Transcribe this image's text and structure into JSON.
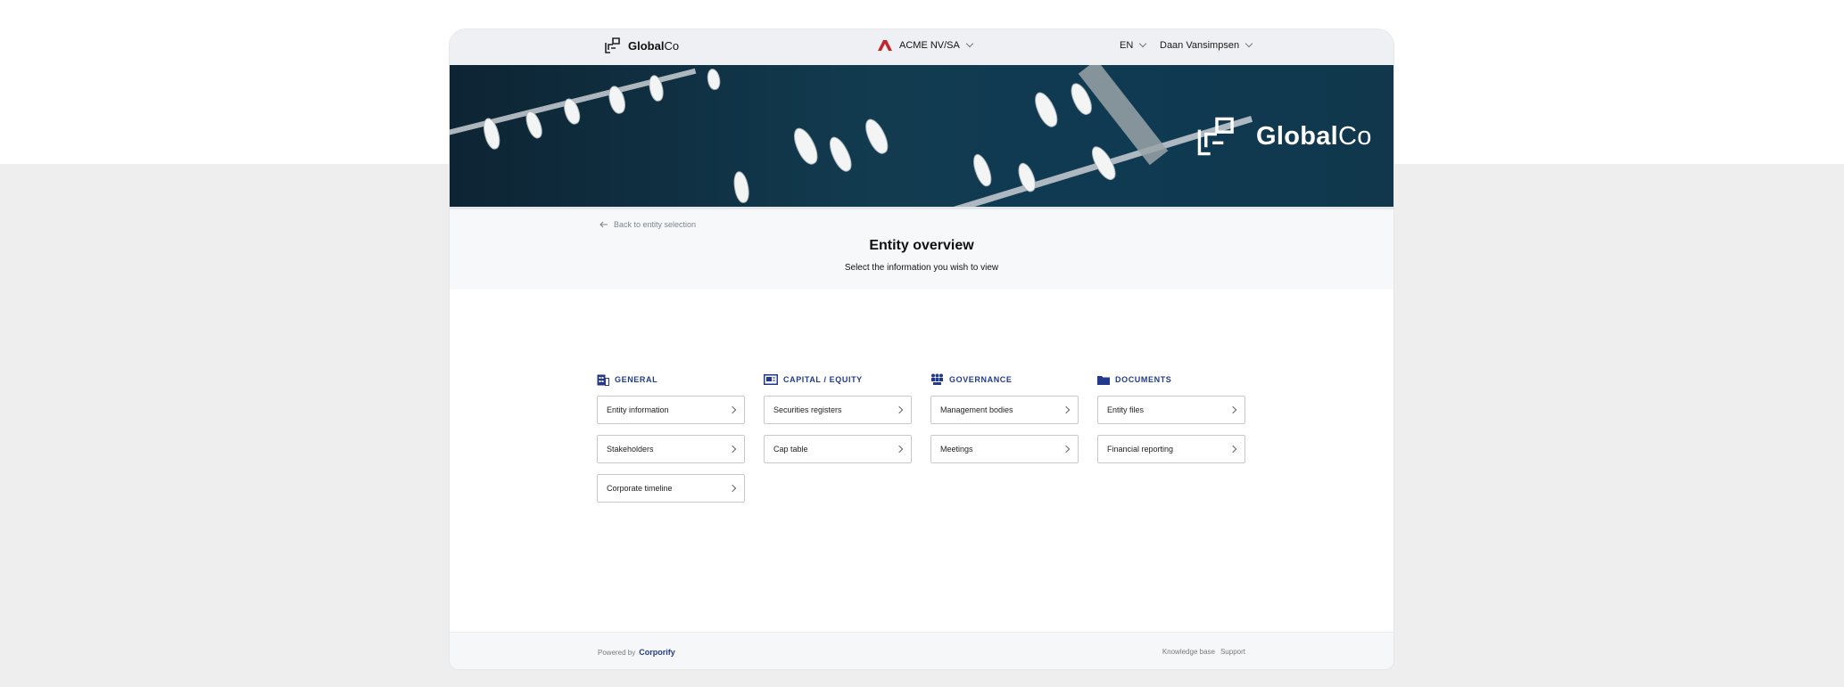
{
  "header": {
    "brand_bold": "Global",
    "brand_regular": "Co",
    "entity_name": "ACME NV/SA",
    "language": "EN",
    "user_name": "Daan Vansimpsen"
  },
  "banner": {
    "brand_bold": "Global",
    "brand_regular": "Co"
  },
  "intro": {
    "back_label": "Back to entity selection",
    "title": "Entity overview",
    "subtitle": "Select the information you wish to view"
  },
  "sections": {
    "general": {
      "title": "GENERAL",
      "icon": "building-icon",
      "items": [
        "Entity information",
        "Stakeholders",
        "Corporate timeline"
      ]
    },
    "capital": {
      "title": "CAPITAL / EQUITY",
      "icon": "certificate-icon",
      "items": [
        "Securities registers",
        "Cap table"
      ]
    },
    "governance": {
      "title": "GOVERNANCE",
      "icon": "people-icon",
      "items": [
        "Management bodies",
        "Meetings"
      ]
    },
    "documents": {
      "title": "DOCUMENTS",
      "icon": "folder-icon",
      "items": [
        "Entity files",
        "Financial reporting"
      ]
    }
  },
  "footer": {
    "powered_by": "Powered by",
    "powered_brand": "Corporify",
    "knowledge_base": "Knowledge base",
    "support": "Support"
  },
  "colors": {
    "accent": "#233a8c",
    "entity_logo": "#c0282d",
    "page_background": "#eeeeee",
    "banner_water": "#123b50"
  }
}
